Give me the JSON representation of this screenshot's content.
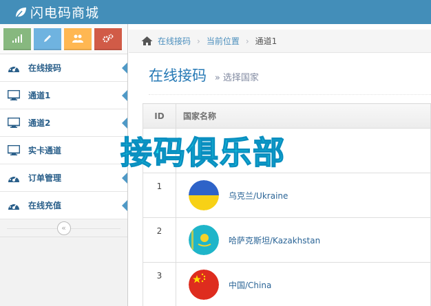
{
  "app": {
    "title": "闪电码商城"
  },
  "sidebar": {
    "shortcuts": [
      {
        "icon": "signal-icon",
        "color": "#87b87f"
      },
      {
        "icon": "pencil-icon",
        "color": "#6fb3e0"
      },
      {
        "icon": "users-icon",
        "color": "#ffb752"
      },
      {
        "icon": "cogs-icon",
        "color": "#d15b47"
      }
    ],
    "items": [
      {
        "label": "在线接码",
        "icon": "dashboard-icon"
      },
      {
        "label": "通道1",
        "icon": "desktop-icon"
      },
      {
        "label": "通道2",
        "icon": "desktop-icon"
      },
      {
        "label": "实卡通道",
        "icon": "desktop-icon"
      },
      {
        "label": "订单管理",
        "icon": "dashboard-icon"
      },
      {
        "label": "在线充值",
        "icon": "dashboard-icon"
      }
    ],
    "collapse_label": "«"
  },
  "breadcrumb": {
    "items": [
      "在线接码",
      "当前位置",
      "通道1"
    ]
  },
  "page_header": {
    "title": "在线接码",
    "subtitle": "» 选择国家"
  },
  "table": {
    "headers": [
      "ID",
      "国家名称"
    ],
    "rows": [
      {
        "id": "1",
        "name": "乌克兰/Ukraine",
        "flag": "ukraine"
      },
      {
        "id": "2",
        "name": "哈萨克斯坦/Kazakhstan",
        "flag": "kazakhstan"
      },
      {
        "id": "3",
        "name": "中国/China",
        "flag": "china"
      }
    ]
  },
  "watermark": {
    "text": "接码俱乐部"
  },
  "colors": {
    "topbar": "#438eb9",
    "link": "#4c8fbd",
    "title": "#2679b5"
  }
}
